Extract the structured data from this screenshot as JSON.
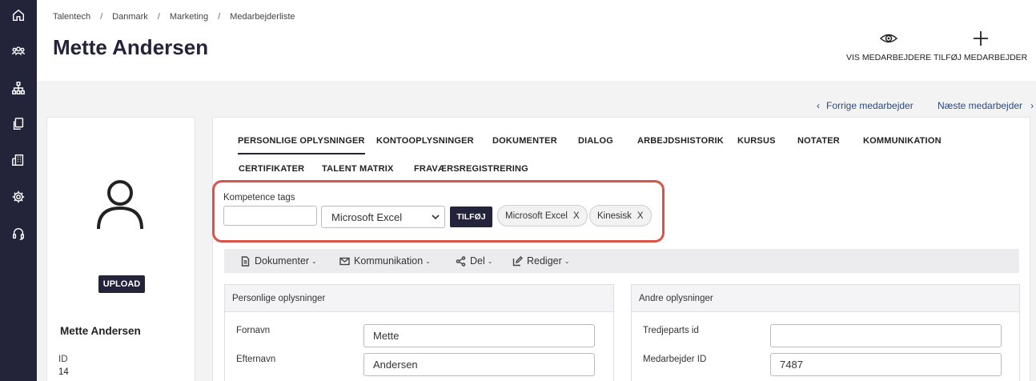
{
  "rail": {
    "icons": [
      "home-icon",
      "people-icon",
      "org-chart-icon",
      "documents-icon",
      "building-icon",
      "settings-icon",
      "support-icon"
    ]
  },
  "breadcrumb": [
    "Talentech",
    "Danmark",
    "Marketing",
    "Medarbejderliste"
  ],
  "page_title": "Mette Andersen",
  "header_actions": {
    "view_employees": "VIS MEDARBEJDERE",
    "add_employee": "TILFØJ MEDARBEJDER"
  },
  "pager": {
    "prev": "Forrige medarbejder",
    "next": "Næste medarbejder"
  },
  "profile": {
    "upload": "UPLOAD",
    "name": "Mette Andersen",
    "id_label": "ID",
    "id_value": "14"
  },
  "tabs": [
    "PERSONLIGE OPLYSNINGER",
    "KONTOOPLYSNINGER",
    "DOKUMENTER",
    "DIALOG",
    "ARBEJDSHISTORIK",
    "KURSUS",
    "NOTATER",
    "KOMMUNIKATION",
    "CERTIFIKATER",
    "TALENT MATRIX",
    "FRAVÆRSREGISTRERING"
  ],
  "competence": {
    "label": "Kompetence tags",
    "input_value": "",
    "selected_option": "Microsoft Excel",
    "add_button": "TILFØJ",
    "tags": [
      "Microsoft Excel",
      "Kinesisk"
    ],
    "remove_glyph": "X"
  },
  "toolbar": {
    "documents": "Dokumenter",
    "communication": "Kommunikation",
    "share": "Del",
    "edit": "Rediger"
  },
  "personal_panel": {
    "title": "Personlige oplysninger",
    "first_name_label": "Fornavn",
    "first_name_value": "Mette",
    "last_name_label": "Efternavn",
    "last_name_value": "Andersen"
  },
  "other_panel": {
    "title": "Andre oplysninger",
    "third_party_label": "Tredjeparts id",
    "third_party_value": "",
    "employee_id_label": "Medarbejder ID",
    "employee_id_value": "7487"
  },
  "colors": {
    "navy": "#23243a",
    "highlight": "#d9534a",
    "link": "#2b4a7a"
  }
}
